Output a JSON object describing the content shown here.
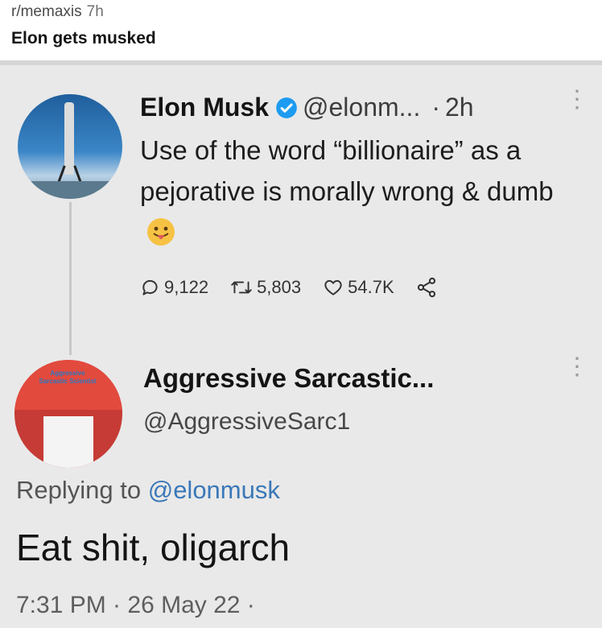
{
  "post": {
    "subreddit": "r/memaxis",
    "age": "7h",
    "title": "Elon gets musked"
  },
  "tweet": {
    "name": "Elon Musk",
    "handle": "@elonm...",
    "separator": "·",
    "time": "2h",
    "text": "Use of the word “billionaire” as a pejorative is morally wrong & dumb",
    "stats": {
      "replies": "9,122",
      "retweets": "5,803",
      "likes": "54.7K"
    }
  },
  "reply": {
    "name": "Aggressive Sarcastic...",
    "handle": "@AggressiveSarc1",
    "avatar_text": "Aggressive Sarcastic Scientist",
    "replying_prefix": "Replying to",
    "replying_mention": "@elonmusk",
    "text": "Eat shit, oligarch",
    "timestamp": "7:31 PM · 26 May 22 ·"
  },
  "colors": {
    "verified": "#1d9bf0",
    "mention": "#3a78b8",
    "avatar_bg": "#c63b35"
  }
}
